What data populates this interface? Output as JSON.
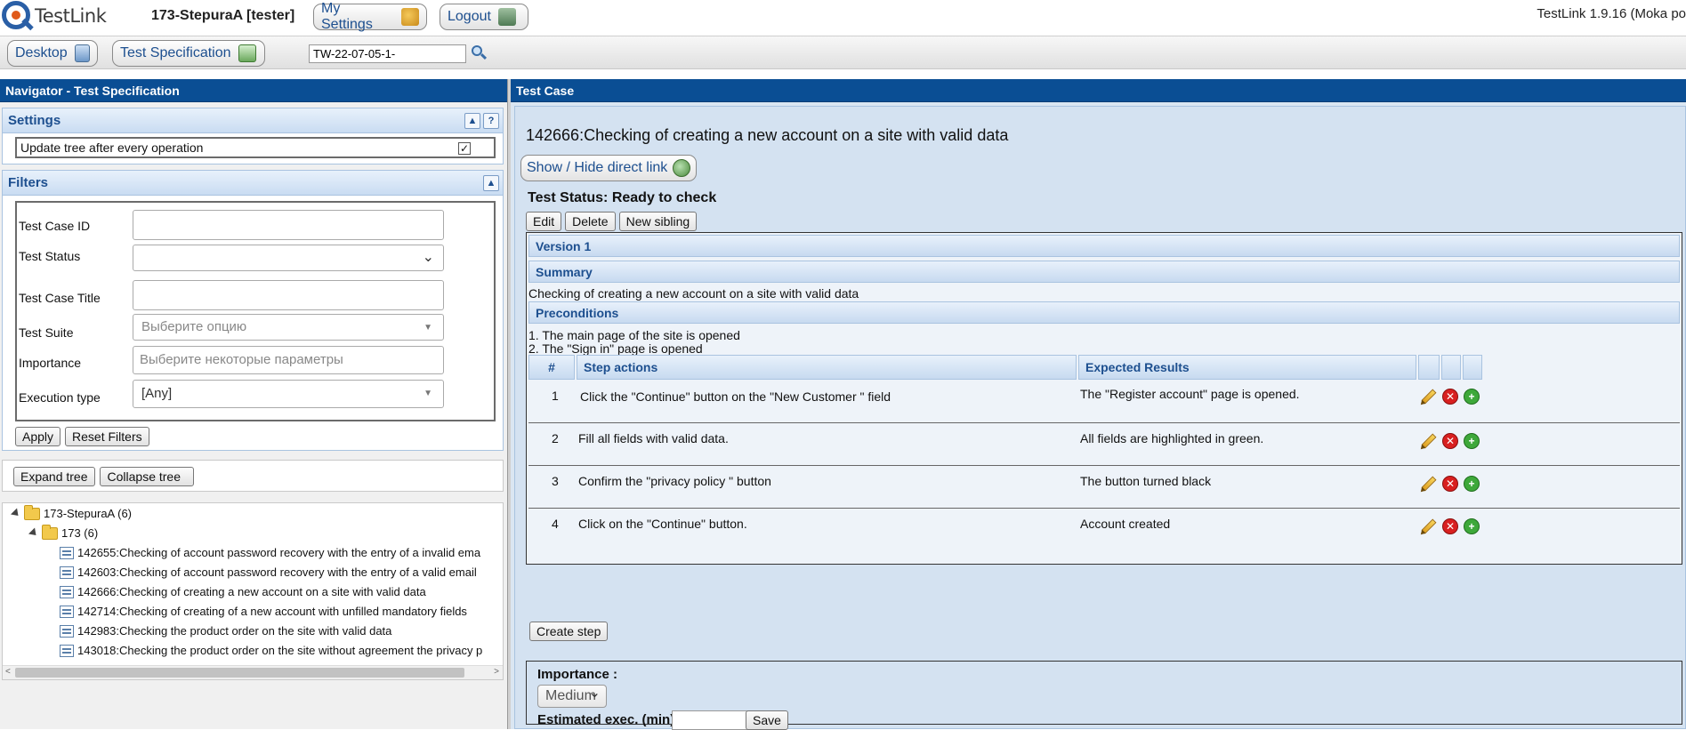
{
  "header": {
    "logo_text": "TestLink",
    "user": "173-StepuraA [tester]",
    "my_settings": "My Settings",
    "logout": "Logout",
    "version": "TestLink 1.9.16 (Moka po"
  },
  "nav": {
    "desktop": "Desktop",
    "test_spec": "Test Specification",
    "search_value": "TW-22-07-05-1-"
  },
  "left": {
    "title": "Navigator - Test Specification",
    "settings": {
      "title": "Settings",
      "update_tree": "Update tree after every operation",
      "update_tree_checked": "✓"
    },
    "filters": {
      "title": "Filters",
      "rows": [
        {
          "label": "Test Case ID",
          "value": ""
        },
        {
          "label": "Test Status",
          "value": ""
        },
        {
          "label": "Test Case Title",
          "value": ""
        },
        {
          "label": "Test Suite",
          "value": "Выберите опцию"
        },
        {
          "label": "Importance",
          "value": "Выберите некоторые параметры"
        },
        {
          "label": "Execution type",
          "value": "[Any]"
        }
      ],
      "apply": "Apply",
      "reset": "Reset Filters"
    },
    "tree_buttons": {
      "expand": "Expand tree",
      "collapse": "Collapse tree"
    },
    "tree": {
      "root": "173-StepuraA (6)",
      "suite": "173 (6)",
      "items": [
        "142655:Checking of account password recovery with the entry of a invalid ema",
        "142603:Checking of account password recovery with the entry of a valid email",
        "142666:Checking of creating a new account on a site with valid data",
        "142714:Checking of creating of a new account with unfilled mandatory fields",
        "142983:Checking the product order on the site with valid data",
        "143018:Checking the product order on the site without agreement the privacy p"
      ]
    }
  },
  "right": {
    "title": "Test Case",
    "tc_title": "142666:Checking of creating a new account on a site with valid data",
    "direct_link": "Show / Hide direct link",
    "status": "Test Status: Ready to check",
    "actions": {
      "edit": "Edit",
      "delete": "Delete",
      "new_sibling": "New sibling"
    },
    "version": "Version 1",
    "summary_title": "Summary",
    "summary": "Checking of creating a new account on a site with valid data",
    "preconditions_title": "Preconditions",
    "preconditions": [
      "1. The main page of the site is opened",
      "2. The \"Sign in\" page is opened"
    ],
    "steps_header": {
      "num": "#",
      "actions": "Step actions",
      "expected": "Expected Results"
    },
    "steps": [
      {
        "num": "1",
        "action": "Click the \"Continue\" button on the \"New Customer \" field",
        "expected": "The \"Register account\" page is opened."
      },
      {
        "num": "2",
        "action": "Fill all fields with valid data.",
        "expected": "All fields are highlighted in green."
      },
      {
        "num": "3",
        "action": "Confirm the \"privacy policy \" button",
        "expected": "The button turned black"
      },
      {
        "num": "4",
        "action": "Click on the \"Continue\" button.",
        "expected": "Account created"
      }
    ],
    "create_step": "Create step",
    "importance_label": "Importance :",
    "importance_value": "Medium",
    "estimated_label": "Estimated exec. (min) :",
    "save": "Save"
  }
}
